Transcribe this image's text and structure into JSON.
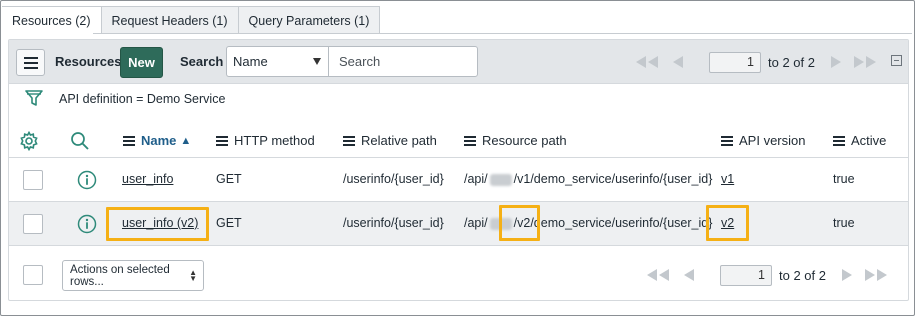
{
  "tabs": [
    {
      "label": "Resources (2)",
      "active": true
    },
    {
      "label": "Request Headers (1)",
      "active": false
    },
    {
      "label": "Query Parameters (1)",
      "active": false
    }
  ],
  "toolbar": {
    "title": "Resources",
    "new_label": "New",
    "search_label": "Search",
    "search_field_selected": "Name",
    "search_placeholder": "Search",
    "page_value": "1",
    "page_range": "to 2 of 2"
  },
  "filter": {
    "text": "API definition = Demo Service"
  },
  "columns": [
    {
      "label": "Name",
      "sort": "▲"
    },
    {
      "label": "HTTP method"
    },
    {
      "label": "Relative path"
    },
    {
      "label": "Resource path"
    },
    {
      "label": "API version"
    },
    {
      "label": "Active"
    }
  ],
  "rows": [
    {
      "name": "user_info",
      "http_method": "GET",
      "relative_path": "/userinfo/{user_id}",
      "resource_path_prefix": "/api/",
      "resource_path_version": "/v1",
      "resource_path_suffix": "/demo_service/userinfo/{user_id}",
      "api_version": "v1",
      "active": "true"
    },
    {
      "name": "user_info (v2)",
      "http_method": "GET",
      "relative_path": "/userinfo/{user_id}",
      "resource_path_prefix": "/api/",
      "resource_path_version": "/v2",
      "resource_path_suffix": "/demo_service/userinfo/{user_id}",
      "api_version": "v2",
      "active": "true"
    }
  ],
  "footer": {
    "actions_label": "Actions on selected rows...",
    "page_value": "1",
    "page_range": "to 2 of 2"
  },
  "colors": {
    "new_button": "#2e6b5a",
    "highlight": "#f5b015",
    "icon_teal": "#2e8a7a"
  },
  "icons": {
    "menu": "hamburger-icon",
    "filter": "funnel-icon",
    "gear": "gear-icon",
    "search": "magnifier-icon",
    "info": "info-circle-icon"
  }
}
